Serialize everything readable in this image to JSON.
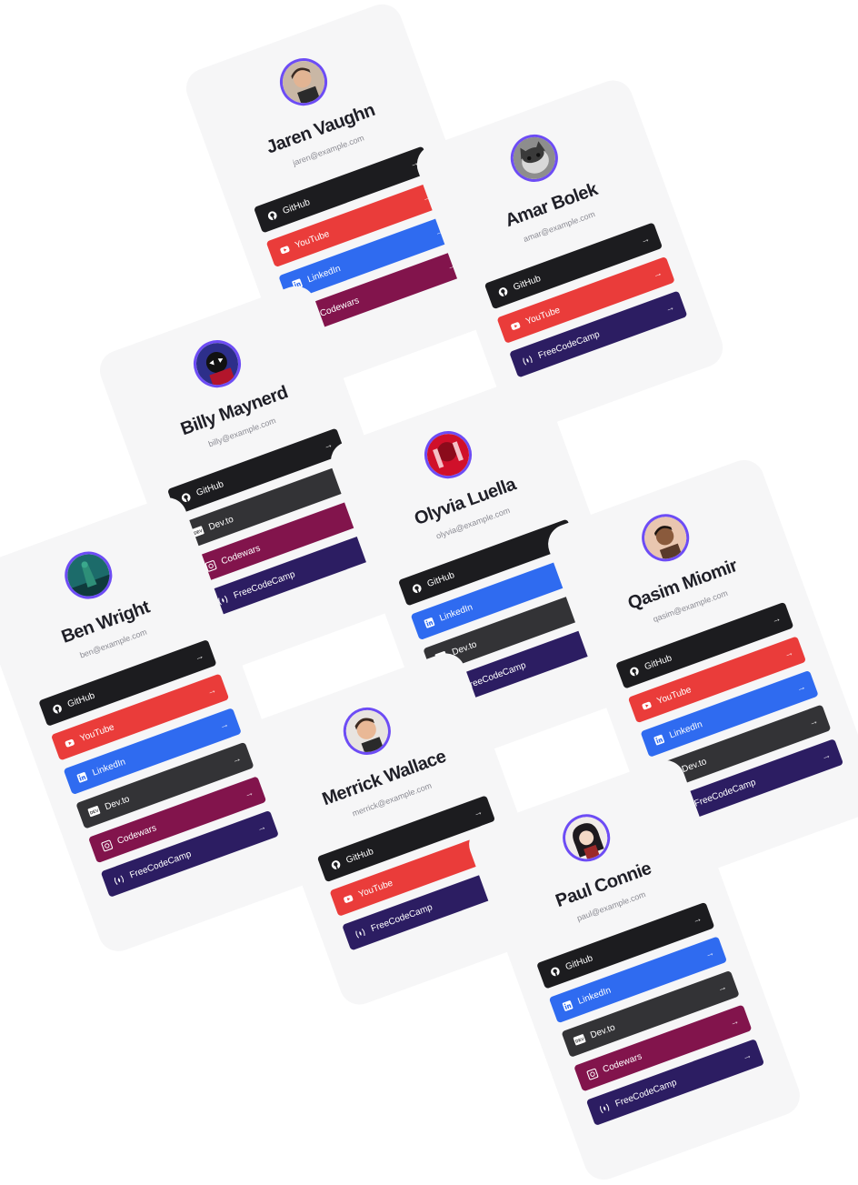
{
  "colors": {
    "accent": "#6d4cf5",
    "card": "#f6f6f7",
    "github": "#1c1c1f",
    "youtube": "#ea3c3a",
    "linkedin": "#2f6bf0",
    "codewars": "#82144c",
    "devto": "#333336",
    "freecodecamp": "#2c1d62"
  },
  "profiles": [
    {
      "name": "Jaren Vaughn",
      "email": "jaren@example.com",
      "links": [
        {
          "label": "GitHub",
          "icon": "github-icon"
        },
        {
          "label": "YouTube",
          "icon": "youtube-icon"
        },
        {
          "label": "LinkedIn",
          "icon": "linkedin-icon"
        },
        {
          "label": "Codewars",
          "icon": "codewars-icon"
        }
      ]
    },
    {
      "name": "Amar Bolek",
      "email": "amar@example.com",
      "links": [
        {
          "label": "GitHub",
          "icon": "github-icon"
        },
        {
          "label": "YouTube",
          "icon": "youtube-icon"
        },
        {
          "label": "FreeCodeCamp",
          "icon": "freecodecamp-icon"
        }
      ]
    },
    {
      "name": "Billy Maynerd",
      "email": "billy@example.com",
      "links": [
        {
          "label": "GitHub",
          "icon": "github-icon"
        },
        {
          "label": "Dev.to",
          "icon": "devto-icon"
        },
        {
          "label": "Codewars",
          "icon": "codewars-icon"
        },
        {
          "label": "FreeCodeCamp",
          "icon": "freecodecamp-icon"
        }
      ]
    },
    {
      "name": "Olyvia Luella",
      "email": "olyvia@example.com",
      "links": [
        {
          "label": "GitHub",
          "icon": "github-icon"
        },
        {
          "label": "LinkedIn",
          "icon": "linkedin-icon"
        },
        {
          "label": "Dev.to",
          "icon": "devto-icon"
        },
        {
          "label": "FreeCodeCamp",
          "icon": "freecodecamp-icon"
        }
      ]
    },
    {
      "name": "Ben Wright",
      "email": "ben@example.com",
      "links": [
        {
          "label": "GitHub",
          "icon": "github-icon"
        },
        {
          "label": "YouTube",
          "icon": "youtube-icon"
        },
        {
          "label": "LinkedIn",
          "icon": "linkedin-icon"
        },
        {
          "label": "Dev.to",
          "icon": "devto-icon"
        },
        {
          "label": "Codewars",
          "icon": "codewars-icon"
        },
        {
          "label": "FreeCodeCamp",
          "icon": "freecodecamp-icon"
        }
      ]
    },
    {
      "name": "Qasim Miomir",
      "email": "qasim@example.com",
      "links": [
        {
          "label": "GitHub",
          "icon": "github-icon"
        },
        {
          "label": "YouTube",
          "icon": "youtube-icon"
        },
        {
          "label": "LinkedIn",
          "icon": "linkedin-icon"
        },
        {
          "label": "Dev.to",
          "icon": "devto-icon"
        },
        {
          "label": "FreeCodeCamp",
          "icon": "freecodecamp-icon"
        }
      ]
    },
    {
      "name": "Merrick Wallace",
      "email": "merrick@example.com",
      "links": [
        {
          "label": "GitHub",
          "icon": "github-icon"
        },
        {
          "label": "YouTube",
          "icon": "youtube-icon"
        },
        {
          "label": "FreeCodeCamp",
          "icon": "freecodecamp-icon"
        }
      ]
    },
    {
      "name": "Paul Connie",
      "email": "paul@example.com",
      "links": [
        {
          "label": "GitHub",
          "icon": "github-icon"
        },
        {
          "label": "LinkedIn",
          "icon": "linkedin-icon"
        },
        {
          "label": "Dev.to",
          "icon": "devto-icon"
        },
        {
          "label": "Codewars",
          "icon": "codewars-icon"
        },
        {
          "label": "FreeCodeCamp",
          "icon": "freecodecamp-icon"
        }
      ]
    }
  ]
}
